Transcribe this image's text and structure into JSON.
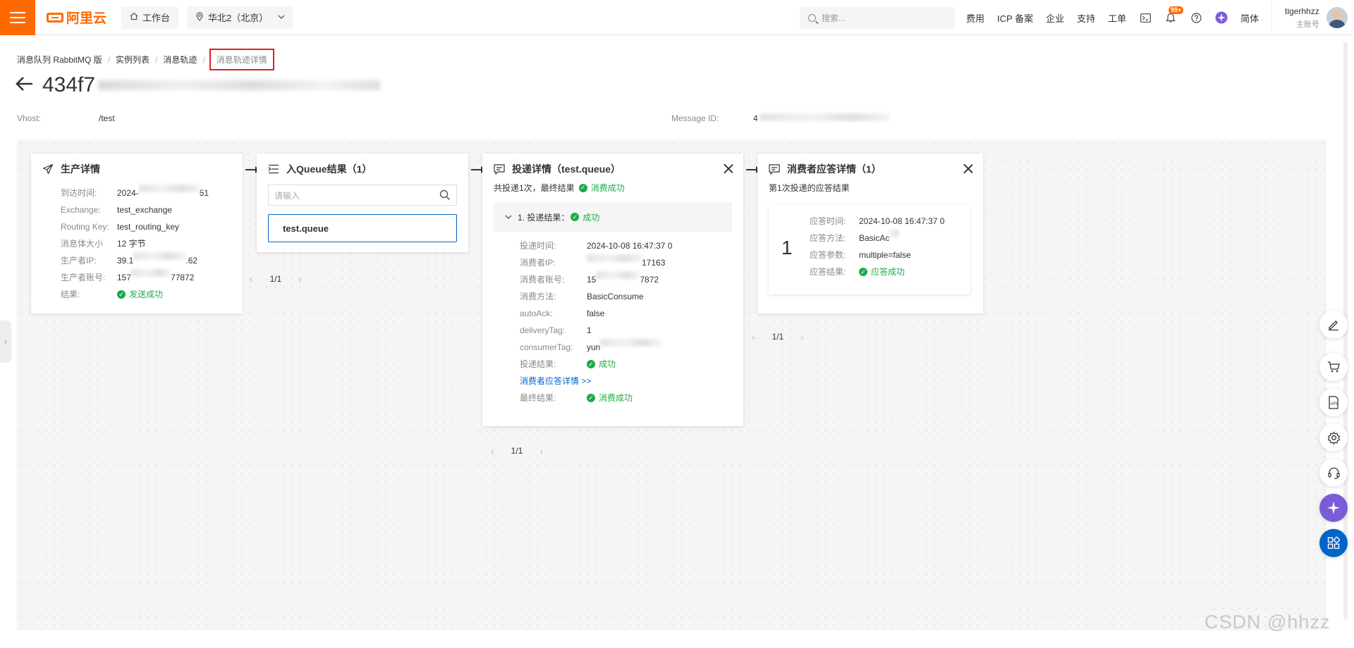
{
  "topbar": {
    "logo_text": "阿里云",
    "workbench_label": "工作台",
    "region_label": "华北2（北京）",
    "search_placeholder": "搜索...",
    "links": [
      "费用",
      "ICP 备案",
      "企业",
      "支持",
      "工单"
    ],
    "notification_badge": "99+",
    "language_label": "简体",
    "user_name": "tigerhhzz",
    "user_role": "主账号",
    "brand_color": "#ff6a00"
  },
  "breadcrumb": {
    "items": [
      "消息队列 RabbitMQ 版",
      "实例列表",
      "消息轨迹"
    ],
    "current": "消息轨迹详情"
  },
  "header": {
    "title_prefix": "434f7",
    "vhost_label": "Vhost:",
    "vhost_value": "/test",
    "message_id_label": "Message ID:",
    "message_id_value": "4"
  },
  "producer": {
    "title": "生产详情",
    "rows": [
      {
        "key": "到达时间:",
        "value": "2024-",
        "tail": "51"
      },
      {
        "key": "Exchange:",
        "value": "test_exchange"
      },
      {
        "key": "Routing Key:",
        "value": "test_routing_key"
      },
      {
        "key": "消息体大小",
        "value": "12 字节"
      },
      {
        "key": "生产者IP:",
        "value": "39.1",
        "tail": ".62"
      },
      {
        "key": "生产者账号:",
        "value": "157",
        "tail": "77872"
      }
    ],
    "result_key": "结果:",
    "result_value": "发送成功"
  },
  "queue": {
    "title": "入Queue结果（1）",
    "search_placeholder": "请输入",
    "items": [
      "test.queue"
    ],
    "pager": "1/1"
  },
  "delivery": {
    "title": "投递详情（test.queue）",
    "summary_prefix": "共投递1次，最终结果",
    "summary_status": "消费成功",
    "attempt_label": "1. 投递结果：",
    "attempt_status": "成功",
    "rows": [
      {
        "key": "投递时间:",
        "value": "2024-10-08 16:47:37 0"
      },
      {
        "key": "消费者IP:",
        "value": "",
        "tail": "17163"
      },
      {
        "key": "消费者账号:",
        "value": "15",
        "tail": "7872"
      },
      {
        "key": "消费方法:",
        "value": "BasicConsume"
      },
      {
        "key": "autoAck:",
        "value": "false"
      },
      {
        "key": "deliveryTag:",
        "value": "1"
      },
      {
        "key": "consumerTag:",
        "value": "yun"
      }
    ],
    "result_key": "投递结果:",
    "result_value": "成功",
    "ack_link": "消费者应答详情 >>",
    "final_key": "最终结果:",
    "final_value": "消费成功",
    "pager": "1/1"
  },
  "ack": {
    "title": "消费者应答详情（1）",
    "subtitle": "第1次投递的应答结果",
    "index": "1",
    "rows": [
      {
        "key": "应答时间:",
        "value": "2024-10-08 16:47:37 0"
      },
      {
        "key": "应答方法:",
        "value": "BasicAc"
      },
      {
        "key": "应答参数:",
        "value": "multiple=false"
      }
    ],
    "result_key": "应答结果:",
    "result_value": "应答成功",
    "pager": "1/1"
  },
  "watermark": "CSDN @hhzz",
  "status_color_success": "#1dab48",
  "link_color": "#0064c8"
}
